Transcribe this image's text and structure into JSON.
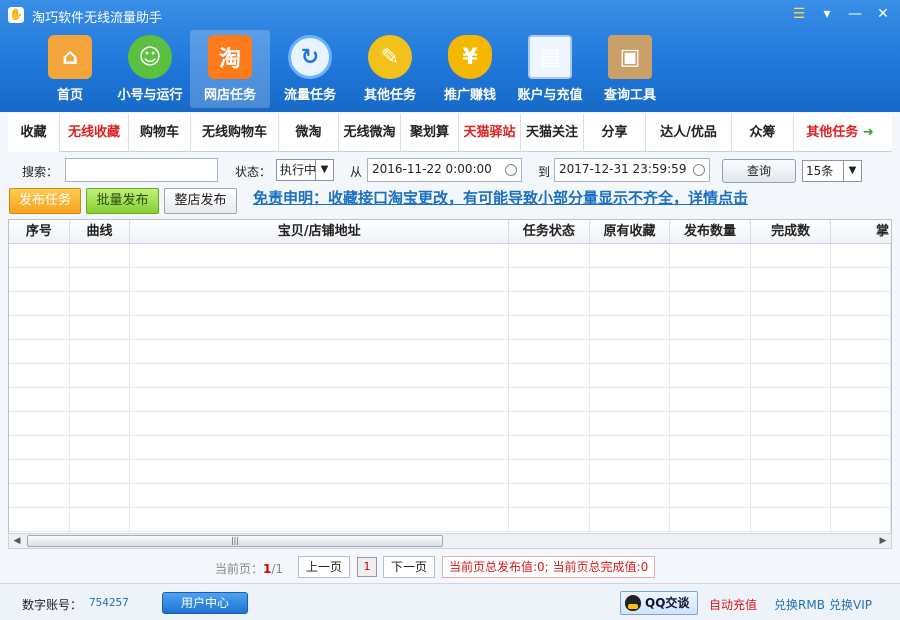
{
  "window": {
    "title": "淘巧软件无线流量助手",
    "controls": [
      "☰",
      "▾",
      "—",
      "✕"
    ]
  },
  "nav": {
    "items": [
      {
        "label": "首页",
        "icon": "home-icon"
      },
      {
        "label": "小号与运行",
        "icon": "user-icon"
      },
      {
        "label": "网店任务",
        "icon": "taobao-icon"
      },
      {
        "label": "流量任务",
        "icon": "refresh-icon"
      },
      {
        "label": "其他任务",
        "icon": "pencil-icon"
      },
      {
        "label": "推广赚钱",
        "icon": "money-bag-icon"
      },
      {
        "label": "账户与充值",
        "icon": "window-icon"
      },
      {
        "label": "查询工具",
        "icon": "box-icon"
      }
    ],
    "active_index": 2
  },
  "tabs": [
    {
      "label": "收藏",
      "color": "#222222"
    },
    {
      "label": "无线收藏",
      "color": "#e02020"
    },
    {
      "label": "购物车",
      "color": "#222222"
    },
    {
      "label": "无线购物车",
      "color": "#222222"
    },
    {
      "label": "微淘",
      "color": "#222222"
    },
    {
      "label": "无线微淘",
      "color": "#222222"
    },
    {
      "label": "聚划算",
      "color": "#222222"
    },
    {
      "label": "天猫驿站",
      "color": "#e02020"
    },
    {
      "label": "天猫关注",
      "color": "#222222"
    },
    {
      "label": "分享",
      "color": "#222222"
    },
    {
      "label": "达人/优品",
      "color": "#222222"
    },
    {
      "label": "众筹",
      "color": "#222222"
    },
    {
      "label": "其他任务",
      "color": "#e02020"
    }
  ],
  "search": {
    "search_label": "搜索：",
    "search_value": "",
    "status_label": "状态：",
    "status_value": "执行中",
    "from_label": "从",
    "from_value": "2016-11-22 0:00:00",
    "to_label": "到",
    "to_value": "2017-12-31 23:59:59",
    "query_label": "查询",
    "page_size": "15条"
  },
  "actions": {
    "publish_label": "发布任务",
    "batch_label": "批量发布",
    "shop_label": "整店发布",
    "disclaimer": "免责申明：收藏接口淘宝更改，有可能导致小部分量显示不齐全，详情点击"
  },
  "table": {
    "headers": [
      "序号",
      "曲线",
      "宝贝/店铺地址",
      "任务状态",
      "原有收藏",
      "发布数量",
      "完成数",
      "掌"
    ],
    "row_count": 12
  },
  "pager": {
    "current_label": "当前页：",
    "current_page": "1",
    "total_pages": "/1",
    "prev_label": "上一页",
    "page_button": "1",
    "next_label": "下一页",
    "totals_text": "当前页总发布值:0; 当前页总完成值:0"
  },
  "status": {
    "account_label": "数字账号：",
    "account_value": "754257",
    "user_center_label": "用户中心",
    "qq_label": "QQ交谈",
    "recharge_label": "自动充值",
    "rmb_label": "兑换RMB",
    "vip_label": "兑换VIP"
  }
}
